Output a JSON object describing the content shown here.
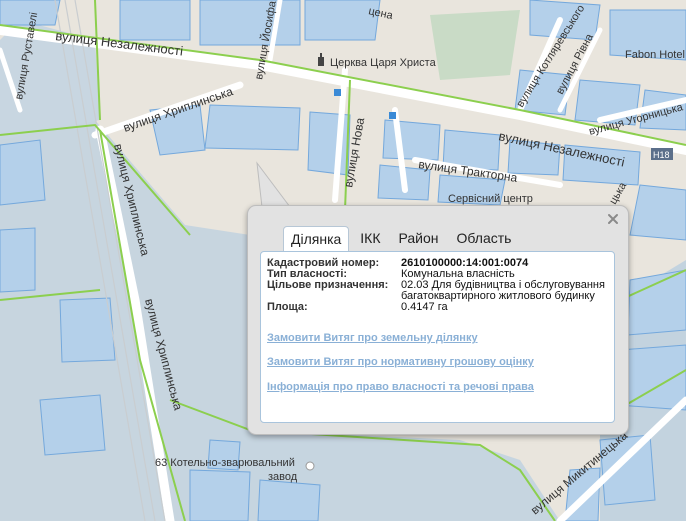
{
  "streets": {
    "nezalezhnosti_left": "вулиця Незалежності",
    "nezalezhnosti_right": "вулиця Незалежності",
    "hrystyna_church": "Церква Царя Христа",
    "khryplynska_top": "вулиця Хриплинська",
    "khryplynska_vertical_1": "вулиця Хриплинська",
    "khryplynska_vertical_2": "вулиця Хриплинська",
    "nova": "вулиця Нова",
    "traktorna": "вулиця Тракторна",
    "servisnyi": "Сервісний центр",
    "kotliarevskoho": "вулиця Котляревського",
    "rivna": "вулиця Рівна",
    "uhornytska": "вулиця Угорницька",
    "hotel": "Fabon Hotel",
    "road_badge": "H18",
    "rustaveli": "вулиця Руставелі",
    "yoslofa": "вулиця Йосифа",
    "tsena": "цена",
    "factory_line1": "63 Котельно-зварювальний",
    "factory_line2": "завод",
    "mykytyntsi": "вулиця Микитинецька",
    "right_edge": "цька"
  },
  "popup": {
    "tabs": [
      "Ділянка",
      "ІКК",
      "Район",
      "Область"
    ],
    "active_tab": 0,
    "fields": [
      {
        "label": "Кадастровий номер:",
        "value": "2610100000:14:001:0074"
      },
      {
        "label": "Тип власності:",
        "value": "Комунальна власність"
      },
      {
        "label": "Цільове призначення:",
        "value": "02.03 Для будівництва і обслуговування багатоквартирного житлового будинку"
      },
      {
        "label": "Площа:",
        "value": "0.4147 га"
      }
    ],
    "links": [
      "Замовити Витяг про земельну ділянку",
      "Замовити Витяг про нормативну грошову оцінку",
      "Інформація про право власності та речові права"
    ]
  },
  "colors": {
    "parcel_fill": "#b4d0ea",
    "parcel_stroke": "#74a8dc",
    "boundary": "#8ccf4e",
    "link": "#8ab0d6"
  }
}
